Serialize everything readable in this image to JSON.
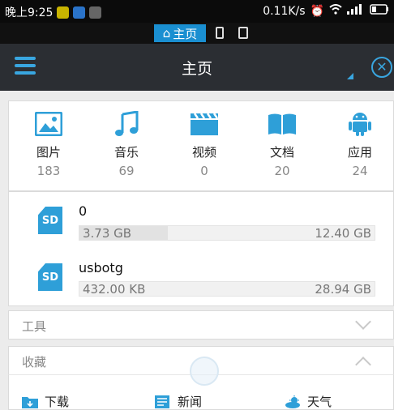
{
  "status_bar": {
    "time": "晚上9:25",
    "speed": "0.11K/s"
  },
  "view_switch": {
    "home_label": "主页"
  },
  "action_bar": {
    "title": "主页"
  },
  "categories": [
    {
      "label": "图片",
      "count": "183",
      "icon": "image-icon"
    },
    {
      "label": "音乐",
      "count": "69",
      "icon": "music-icon"
    },
    {
      "label": "视频",
      "count": "0",
      "icon": "video-icon"
    },
    {
      "label": "文档",
      "count": "20",
      "icon": "document-icon"
    },
    {
      "label": "应用",
      "count": "24",
      "icon": "android-icon"
    }
  ],
  "storage": [
    {
      "badge": "SD",
      "name": "0",
      "used": "3.73 GB",
      "total": "12.40 GB",
      "used_fraction": 0.3
    },
    {
      "badge": "SD",
      "name": "usbotg",
      "used": "432.00 KB",
      "total": "28.94 GB",
      "used_fraction": 0.0
    }
  ],
  "sections": {
    "tools": "工具",
    "favorites": "收藏"
  },
  "favorites": [
    {
      "label": "下载",
      "icon": "folder-download-icon"
    },
    {
      "label": "新闻",
      "icon": "news-icon"
    },
    {
      "label": "天气",
      "icon": "weather-icon"
    }
  ],
  "colors": {
    "accent": "#2e9fd8",
    "action_bar": "#2b2e33"
  }
}
